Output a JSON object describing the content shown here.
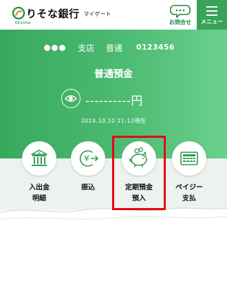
{
  "header": {
    "logo_name": "りそな銀行",
    "logo_sub": "マイゲート",
    "logo_tag": "RESONA",
    "inquiry_label": "お問合せ",
    "menu_label": "メニュー"
  },
  "account": {
    "masked_prefix": "●●●",
    "branch": "支店",
    "type": "普通",
    "number": "0123456",
    "title": "普通預金",
    "balance": "----------円",
    "timestamp": "2024.10.10 21:12現在"
  },
  "actions": [
    {
      "id": "statement",
      "line1": "入出金",
      "line2": "明細",
      "icon": "bank-icon"
    },
    {
      "id": "transfer",
      "line1": "振込",
      "line2": "",
      "icon": "yen-transfer-icon"
    },
    {
      "id": "time-deposit",
      "line1": "定期預金",
      "line2": "預入",
      "icon": "piggy-bank-icon"
    },
    {
      "id": "pay-easy",
      "line1": "ペイジー",
      "line2": "支払",
      "icon": "calculator-icon"
    }
  ],
  "colors": {
    "brand_green": "#3aa35a",
    "highlight_red": "#e60012"
  }
}
